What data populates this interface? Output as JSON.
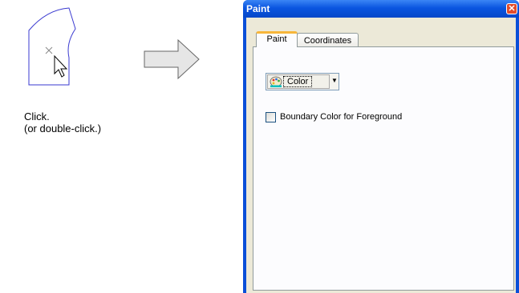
{
  "instruction": {
    "line1": "Click.",
    "line2": "(or double-click.)"
  },
  "dialog": {
    "title": "Paint",
    "close_glyph": "✕",
    "tabs": [
      {
        "label": "Paint",
        "selected": true
      },
      {
        "label": "Coordinates",
        "selected": false
      }
    ],
    "color_dropdown": {
      "value": "Color",
      "icon": "palette-icon"
    },
    "checkbox": {
      "label": "Boundary Color for Foreground",
      "checked": false
    }
  },
  "colors": {
    "title_bar": "#0a55e0",
    "window_bg": "#ece9d8",
    "tab_highlight": "#f7b63a",
    "shape_outline": "#3a3ad0"
  }
}
